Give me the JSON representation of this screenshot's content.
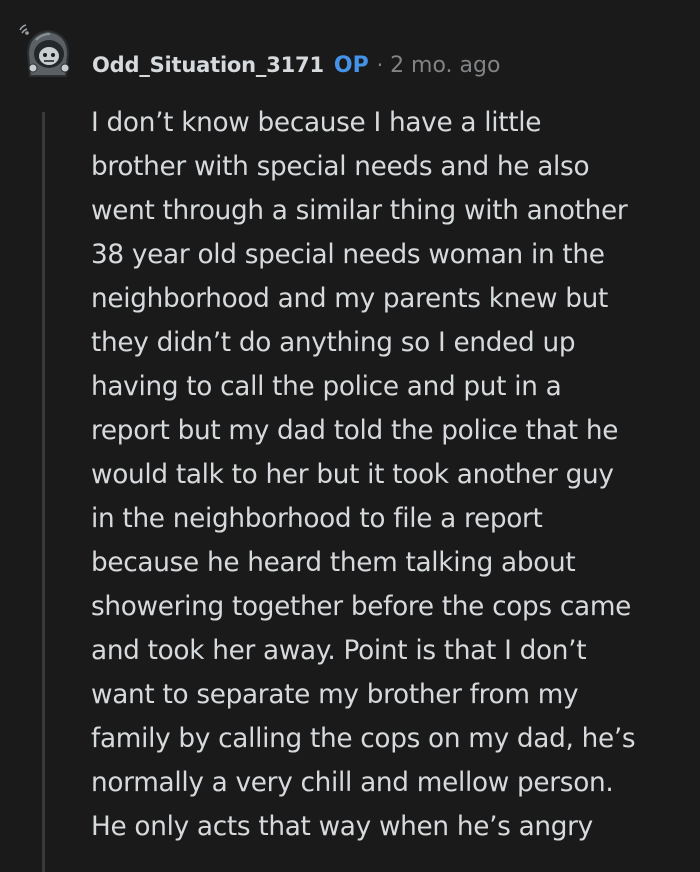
{
  "comment": {
    "author": "Odd_Situation_3171",
    "badge": "OP",
    "separator": "·",
    "age": "2 mo. ago",
    "body_lines": [
      "I don’t know because I have a little",
      "brother with special needs and he also",
      "went through a similar thing with another",
      "38 year old special needs woman in the",
      "neighborhood and my parents knew but",
      "they didn’t do anything so I ended up",
      "having to call the police and put in a",
      "report but my dad told the police that he",
      "would talk to her but it took another guy",
      "in the neighborhood to file a report",
      "because he heard them talking about",
      "showering together before the cops came",
      "and took her away. Point is that I don’t",
      "want to separate my brother from my",
      "family by calling the cops on my dad, he’s",
      "normally a very chill and mellow person.",
      "He only acts that way when he’s angry"
    ]
  },
  "colors": {
    "background": "#1a1a1b",
    "text": "#d7dadc",
    "muted": "#818384",
    "op_accent": "#4493e8",
    "thread_line": "#3a3a3c"
  },
  "icons": {
    "avatar": "snoo-avatar-icon"
  }
}
